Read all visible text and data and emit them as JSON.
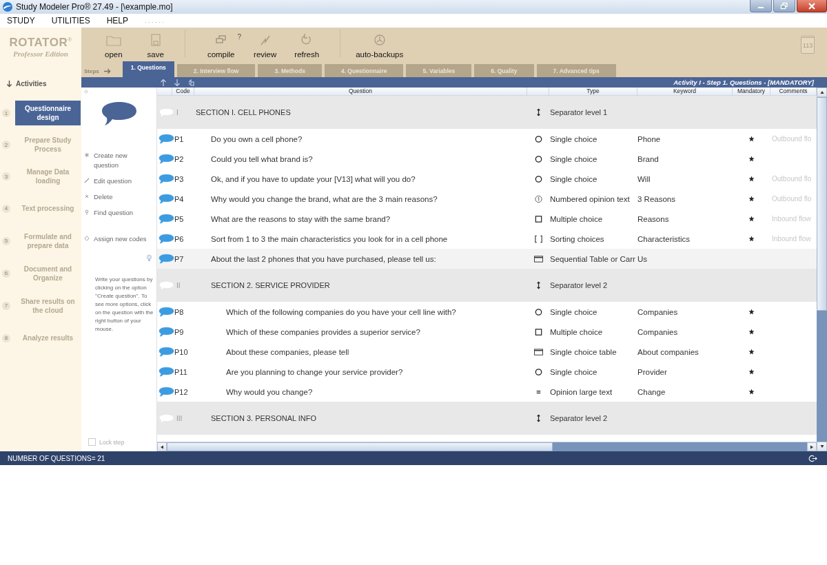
{
  "window": {
    "title": "Study Modeler Pro® 27.49 - [\\example.mo]"
  },
  "menu": [
    {
      "label": "STUDY"
    },
    {
      "label": "UTILITIES"
    },
    {
      "label": "HELP"
    },
    {
      "label": ". . . . . ."
    }
  ],
  "logo": {
    "name": "ROTATOR$^{®}$",
    "edition": "Professor Edition"
  },
  "toolbar": [
    {
      "label": "open"
    },
    {
      "label": "save"
    },
    {
      "label": "compile",
      "help": "?"
    },
    {
      "label": "review"
    },
    {
      "label": "refresh"
    },
    {
      "label": "auto-backups"
    }
  ],
  "calendar": {
    "day": "113"
  },
  "steps": {
    "label": "Steps",
    "tabs": [
      {
        "label": "1. Questions",
        "selected": true
      },
      {
        "label": "2. Interview flow",
        "selected": false
      },
      {
        "label": "3. Methods",
        "selected": false
      },
      {
        "label": "4. Questionnaire",
        "selected": false
      },
      {
        "label": "5. Variables",
        "selected": false
      },
      {
        "label": "6. Quality",
        "selected": false
      },
      {
        "label": "7. Advanced tips",
        "selected": false
      }
    ]
  },
  "activities": {
    "label": "Activities",
    "items": [
      {
        "number": "1",
        "label": "Questionnaire design",
        "selected": true
      },
      {
        "number": "2",
        "label": "Prepare Study Process",
        "selected": false
      },
      {
        "number": "3",
        "label": "Manage Data loading",
        "selected": false
      },
      {
        "number": "4",
        "label": "Text processing",
        "selected": false
      },
      {
        "number": "5",
        "label": "Formulate and prepare data",
        "selected": false
      },
      {
        "number": "6",
        "label": "Document and Organize",
        "selected": false
      },
      {
        "number": "7",
        "label": "Share results on the cloud",
        "selected": false
      },
      {
        "number": "8",
        "label": "Analyze results",
        "selected": false
      }
    ]
  },
  "actions": [
    {
      "label": "Create new question"
    },
    {
      "label": "Edit question"
    },
    {
      "label": "Delete"
    },
    {
      "label": "Find question"
    },
    {
      "label": "Assign new codes"
    }
  ],
  "hint": "Write your questions by clicking on the option ''Create question''. To see more options, click on the question with the right button of your mouse.",
  "lock_step": {
    "label": "Lock step",
    "checked": false
  },
  "panel_title": "Activity I - Step 1. Questions - [MANDATORY]",
  "table": {
    "columns": [
      "Code",
      "Question",
      "Type",
      "Keyword",
      "Mandatory",
      "Comments"
    ],
    "rows": [
      {
        "kind": "separator",
        "code": "I",
        "question": "SECTION I. CELL PHONES",
        "type": "Separator level 1",
        "selected": false,
        "children": [
          {
            "kind": "single",
            "code": "P1",
            "question": "Do you own a cell phone?",
            "type": "Single choice",
            "keyword": "Phone",
            "mandatory": true,
            "comment": "Outbound flo",
            "selected": false
          },
          {
            "kind": "single",
            "code": "P2",
            "question": "Could you tell what brand is?",
            "type": "Single choice",
            "keyword": "Brand",
            "mandatory": true,
            "selected": false
          },
          {
            "kind": "single",
            "code": "P3",
            "question": "Ok, and if you have to update your [V13] what will you do?",
            "type": "Single choice",
            "keyword": "Will",
            "mandatory": true,
            "comment": "Outbound flo",
            "selected": false
          },
          {
            "kind": "numbered",
            "code": "P4",
            "question": "Why would you change the brand, what are the 3 main reasons?",
            "type": "Numbered opinion text",
            "keyword": "3 Reasons",
            "mandatory": true,
            "comment": "Outbound flo",
            "selected": false
          },
          {
            "kind": "multiple",
            "code": "P5",
            "question": "What are the reasons to stay with the same brand?",
            "type": "Multiple choice",
            "keyword": "Reasons",
            "mandatory": true,
            "comment": "Inbound flow",
            "selected": false
          },
          {
            "kind": "sorting",
            "code": "P6",
            "question": "Sort from 1 to 3 the main characteristics you look for in a cell phone",
            "type": "Sorting choices",
            "keyword": "Characteristics",
            "mandatory": true,
            "comment": "Inbound flow",
            "selected": false
          },
          {
            "kind": "table",
            "code": "P7",
            "question": "About the last 2 phones that you have purchased, please tell us:",
            "type": "Sequential Table or Carr",
            "keyword": "Us",
            "mandatory": false,
            "selected": true
          },
          {
            "kind": "separator",
            "code": "II",
            "question": "SECTION 2. SERVICE PROVIDER",
            "type": "Separator level 2",
            "selected": false,
            "children": [
              {
                "kind": "single",
                "code": "P8",
                "question": "Which of the following companies do you have your cell line with?",
                "type": "Single choice",
                "keyword": "Companies",
                "mandatory": true,
                "selected": false
              },
              {
                "kind": "multiple",
                "code": "P9",
                "question": "Which of these companies provides a superior service?",
                "type": "Multiple choice",
                "keyword": "Companies",
                "mandatory": true,
                "selected": false
              },
              {
                "kind": "table",
                "code": "P10",
                "question": "About these companies, please tell",
                "type": "Single choice table",
                "keyword": "About companies",
                "mandatory": true,
                "selected": false
              },
              {
                "kind": "single",
                "code": "P11",
                "question": "Are you planning to change your service provider?",
                "type": "Single choice",
                "keyword": "Provider",
                "mandatory": true,
                "selected": false
              },
              {
                "kind": "opinion",
                "code": "P12",
                "question": "Why would you change?",
                "type": "Opinion large text",
                "keyword": "Change",
                "mandatory": true,
                "selected": false
              }
            ]
          },
          {
            "kind": "separator",
            "code": "III",
            "question": "SECTION 3. PERSONAL INFO",
            "type": "Separator level 2",
            "selected": false
          }
        ]
      }
    ]
  },
  "status_bar": {
    "text": "NUMBER OF QUESTIONS= 21"
  }
}
